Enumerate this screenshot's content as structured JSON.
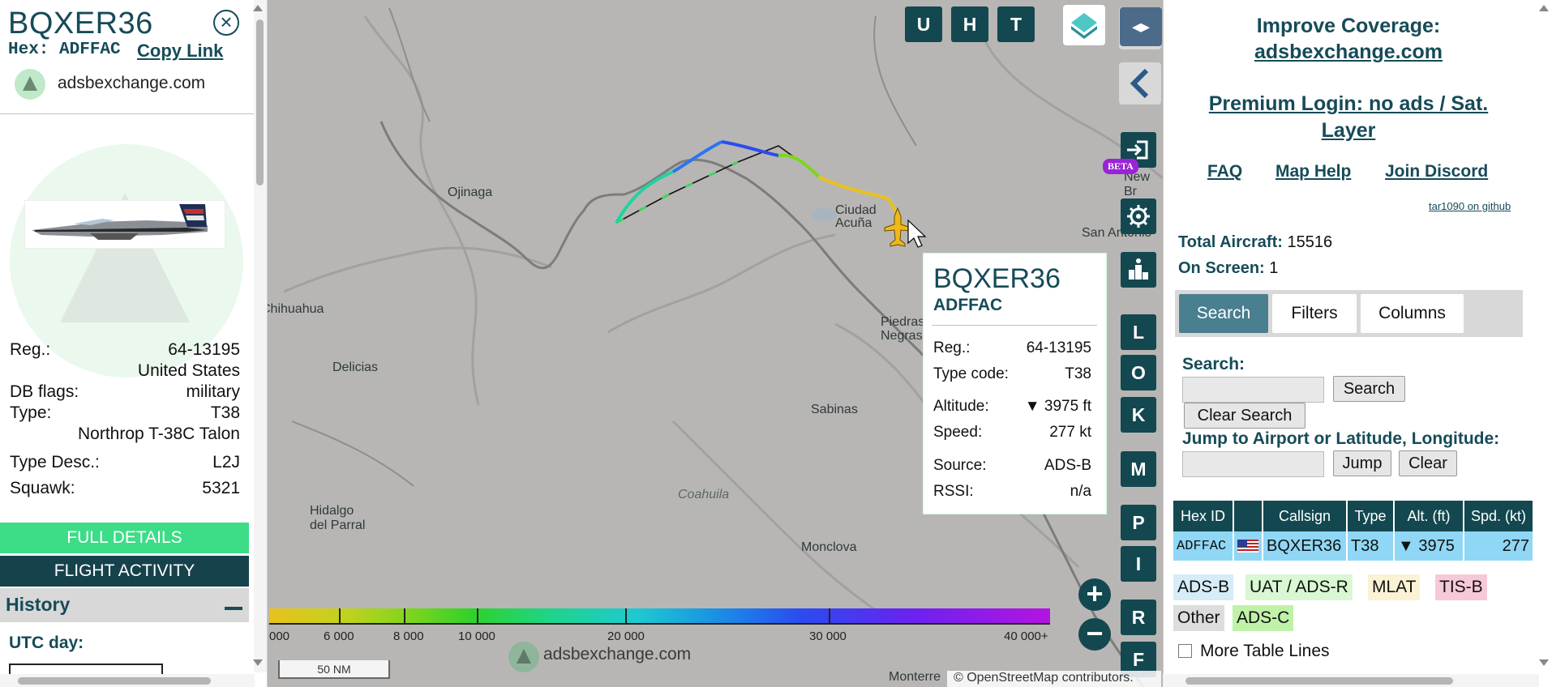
{
  "aircraft": {
    "callsign": "BQXER36",
    "hex_line": "Hex: ADFFAC",
    "copy_link": "Copy Link",
    "source_name": "adsbexchange.com",
    "reg_label": "Reg.:",
    "reg": "64-13195",
    "country": "United States",
    "dbflags_label": "DB flags:",
    "dbflags": "military",
    "type_label": "Type:",
    "type": "T38",
    "type_name": "Northrop T-38C Talon",
    "typedesc_label": "Type Desc.:",
    "typedesc": "L2J",
    "squawk_label": "Squawk:",
    "squawk": "5321"
  },
  "left_buttons": {
    "full_details": "FULL DETAILS",
    "flight_activity": "FLIGHT ACTIVITY",
    "history": "History",
    "utc_day": "UTC day:"
  },
  "map": {
    "labels": [
      "Ojinaga",
      "Ciudad Acuña",
      "San Antonio",
      "New Br",
      "Chihuahua",
      "Delicias",
      "Piedras Negras",
      "Sabinas",
      "Coahuila",
      "Hidalgo del Parral",
      "Monclova",
      "Monterre"
    ],
    "top_buttons": [
      "U",
      "H",
      "T"
    ],
    "side_buttons": [
      "L",
      "O",
      "K",
      "M",
      "P",
      "I",
      "R",
      "F"
    ],
    "beta": "BETA",
    "legend_ticks": [
      "000",
      "6 000",
      "8 000",
      "10 000",
      "20 000",
      "30 000",
      "40 000+"
    ],
    "scale": "50 NM",
    "attribution": "© OpenStreetMap contributors.",
    "watermark": "adsbexchange.com",
    "zoom_in": "+",
    "zoom_out": "−"
  },
  "popup": {
    "callsign": "BQXER36",
    "hex": "ADFFAC",
    "reg_label": "Reg.:",
    "reg": "64-13195",
    "typecode_label": "Type code:",
    "typecode": "T38",
    "altitude_label": "Altitude:",
    "altitude": "▼ 3975 ft",
    "speed_label": "Speed:",
    "speed": "277 kt",
    "source_label": "Source:",
    "source": "ADS-B",
    "rssi_label": "RSSI:",
    "rssi": "n/a"
  },
  "right": {
    "improve1": "Improve Coverage:",
    "improve2": "adsbexchange.com",
    "premium": "Premium Login: no ads / Sat. Layer",
    "faq": "FAQ",
    "map_help": "Map Help",
    "join_discord": "Join Discord",
    "github": "tar1090 on github",
    "total_label": "Total Aircraft:",
    "total": "15516",
    "onscreen_label": "On Screen:",
    "onscreen": "1",
    "tabs": [
      "Search",
      "Filters",
      "Columns"
    ],
    "search_label": "Search:",
    "search_btn": "Search",
    "clear_search": "Clear Search",
    "jump_label": "Jump to Airport or Latitude, Longitude:",
    "jump_btn": "Jump",
    "clear_btn": "Clear",
    "table_headers": [
      "Hex ID",
      "",
      "Callsign",
      "Type",
      "Alt. (ft)",
      "Spd. (kt)"
    ],
    "table_row": {
      "hex": "ADFFAC",
      "callsign": "BQXER36",
      "type": "T38",
      "alt": "▼  3975",
      "spd": "277"
    },
    "sources": [
      "ADS-B",
      "UAT / ADS-R",
      "MLAT",
      "TIS-B",
      "Other",
      "ADS-C"
    ],
    "more_lines": "More Table Lines"
  },
  "colors": {
    "accent": "#164b58",
    "button_dark": "#134850",
    "full_details": "#3ddc87",
    "row": "#8fd7f5"
  }
}
